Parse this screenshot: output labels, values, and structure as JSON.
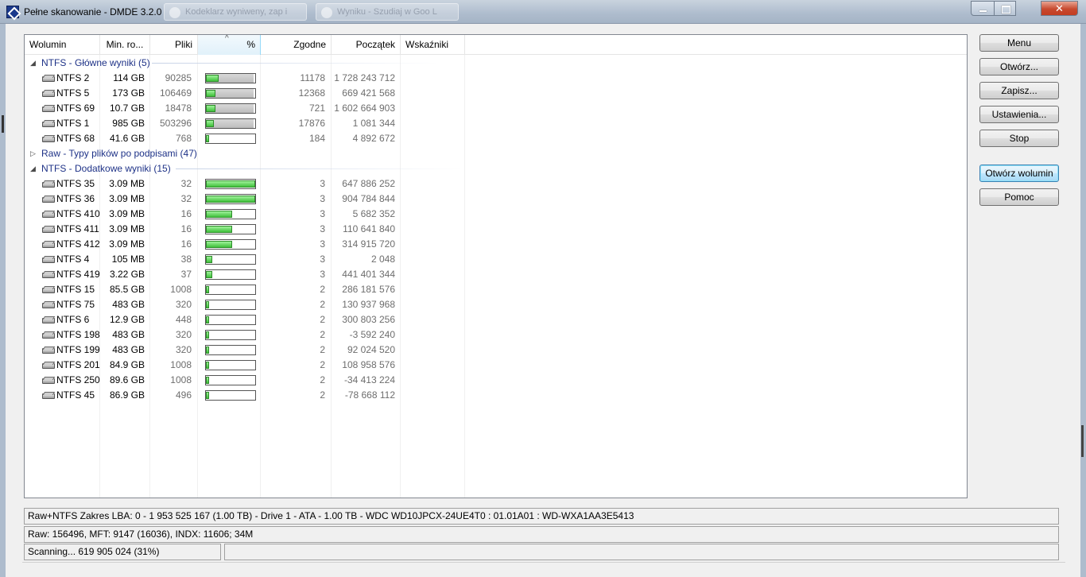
{
  "window": {
    "title": "Pełne skanowanie - DMDE 3.2.0",
    "ghost_tabs": [
      "Kodeklarz wyniweny, zap i",
      "Wyniku - Szudiaj w Goo L"
    ],
    "close_glyph": "✕"
  },
  "columns": {
    "volume": "Wolumin",
    "min_size": "Min. ro...",
    "files": "Pliki",
    "percent": "%",
    "matches": "Zgodne",
    "start": "Początek",
    "indicators": "Wskaźniki",
    "sort_glyph": "^"
  },
  "groups": [
    {
      "label": "NTFS - Główne wyniki (5)",
      "expanded": true,
      "toggle_glyph": "◢",
      "rows": [
        {
          "name": "NTFS 2",
          "size": "114 GB",
          "files": "90285",
          "percent": 0.25,
          "bar_confirmed": true,
          "matches": "11178",
          "start": "1 728 243 712"
        },
        {
          "name": "NTFS 5",
          "size": "173 GB",
          "files": "106469",
          "percent": 0.2,
          "bar_confirmed": true,
          "matches": "12368",
          "start": "669 421 568"
        },
        {
          "name": "NTFS 69",
          "size": "10.7 GB",
          "files": "18478",
          "percent": 0.2,
          "bar_confirmed": true,
          "matches": "721",
          "start": "1 602 664 903"
        },
        {
          "name": "NTFS 1",
          "size": "985 GB",
          "files": "503296",
          "percent": 0.16,
          "bar_confirmed": true,
          "matches": "17876",
          "start": "1 081 344"
        },
        {
          "name": "NTFS 68",
          "size": "41.6 GB",
          "files": "768",
          "percent": 0.06,
          "bar_confirmed": false,
          "matches": "184",
          "start": "4 892 672"
        }
      ]
    },
    {
      "label": "Raw - Typy plików po podpisami (47)",
      "expanded": false,
      "toggle_glyph": "▷",
      "rows": []
    },
    {
      "label": "NTFS - Dodatkowe wyniki (15)",
      "expanded": true,
      "toggle_glyph": "◢",
      "rows": [
        {
          "name": "NTFS 35",
          "size": "3.09 MB",
          "files": "32",
          "percent": 1.0,
          "bar_confirmed": false,
          "matches": "3",
          "start": "647 886 252"
        },
        {
          "name": "NTFS 36",
          "size": "3.09 MB",
          "files": "32",
          "percent": 1.0,
          "bar_confirmed": false,
          "matches": "3",
          "start": "904 784 844"
        },
        {
          "name": "NTFS 410",
          "size": "3.09 MB",
          "files": "16",
          "percent": 0.53,
          "bar_confirmed": false,
          "matches": "3",
          "start": "5 682 352"
        },
        {
          "name": "NTFS 411",
          "size": "3.09 MB",
          "files": "16",
          "percent": 0.53,
          "bar_confirmed": false,
          "matches": "3",
          "start": "110 641 840"
        },
        {
          "name": "NTFS 412",
          "size": "3.09 MB",
          "files": "16",
          "percent": 0.53,
          "bar_confirmed": false,
          "matches": "3",
          "start": "314 915 720"
        },
        {
          "name": "NTFS 4",
          "size": "105 MB",
          "files": "38",
          "percent": 0.13,
          "bar_confirmed": false,
          "matches": "3",
          "start": "2 048"
        },
        {
          "name": "NTFS 419",
          "size": "3.22 GB",
          "files": "37",
          "percent": 0.13,
          "bar_confirmed": false,
          "matches": "3",
          "start": "441 401 344"
        },
        {
          "name": "NTFS 15",
          "size": "85.5 GB",
          "files": "1008",
          "percent": 0.06,
          "bar_confirmed": false,
          "matches": "2",
          "start": "286 181 576"
        },
        {
          "name": "NTFS 75",
          "size": "483 GB",
          "files": "320",
          "percent": 0.06,
          "bar_confirmed": false,
          "matches": "2",
          "start": "130 937 968"
        },
        {
          "name": "NTFS 6",
          "size": "12.9 GB",
          "files": "448",
          "percent": 0.06,
          "bar_confirmed": false,
          "matches": "2",
          "start": "300 803 256"
        },
        {
          "name": "NTFS 198",
          "size": "483 GB",
          "files": "320",
          "percent": 0.06,
          "bar_confirmed": false,
          "matches": "2",
          "start": "-3 592 240"
        },
        {
          "name": "NTFS 199",
          "size": "483 GB",
          "files": "320",
          "percent": 0.06,
          "bar_confirmed": false,
          "matches": "2",
          "start": "92 024 520"
        },
        {
          "name": "NTFS 201",
          "size": "84.9 GB",
          "files": "1008",
          "percent": 0.06,
          "bar_confirmed": false,
          "matches": "2",
          "start": "108 958 576"
        },
        {
          "name": "NTFS 250",
          "size": "89.6 GB",
          "files": "1008",
          "percent": 0.06,
          "bar_confirmed": false,
          "matches": "2",
          "start": "-34 413 224"
        },
        {
          "name": "NTFS 45",
          "size": "86.9 GB",
          "files": "496",
          "percent": 0.06,
          "bar_confirmed": false,
          "matches": "2",
          "start": "-78 668 112"
        }
      ]
    }
  ],
  "buttons": {
    "menu": "Menu",
    "open": "Otwórz...",
    "save": "Zapisz...",
    "settings": "Ustawienia...",
    "stop": "Stop",
    "open_volume": "Otwórz wolumin",
    "help": "Pomoc"
  },
  "status": {
    "line1": "Raw+NTFS Zakres LBA: 0 - 1 953 525 167 (1.00 TB) - Drive 1 - ATA - 1.00 TB - WDC WD10JPCX-24UE4T0 : 01.01A01 : WD-WXA1AA3E5413",
    "line2": "Raw: 156496, MFT: 9147 (16036), INDX: 11606; 34M",
    "line3": "Scanning... 619 905 024 (31%)",
    "line3_progress": ""
  }
}
